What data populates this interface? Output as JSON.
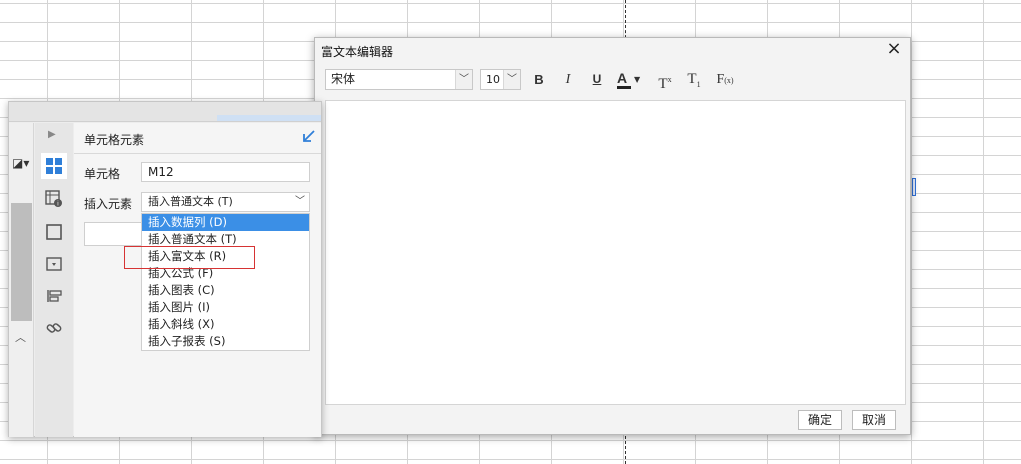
{
  "rich_text_editor": {
    "title": "富文本编辑器",
    "font_family": "宋体",
    "font_size": "10",
    "toolbar": {
      "bold": "B",
      "italic": "I",
      "underline": "U",
      "font_color": "A",
      "superscript": "T",
      "superscript_mark": "x",
      "subscript": "T",
      "subscript_mark": "1",
      "formula": "F",
      "formula_mark": "(x)"
    },
    "ok_label": "确定",
    "cancel_label": "取消"
  },
  "cell_panel": {
    "title": "单元格元素",
    "cell_label": "单元格",
    "cell_value": "M12",
    "insert_label": "插入元素",
    "insert_selected": "插入普通文本 (T)",
    "insert_options": [
      "插入数据列 (D)",
      "插入普通文本 (T)",
      "插入富文本 (R)",
      "插入公式 (F)",
      "插入图表 (C)",
      "插入图片 (I)",
      "插入斜线 (X)",
      "插入子报表 (S)"
    ],
    "highlighted_option_index": 0,
    "boxed_option_index": 2
  },
  "colors": {
    "accent": "#3b8fe6",
    "highlight_box": "#d63333",
    "selection_blue": "#2f6fd6"
  },
  "icons": [
    "close-icon",
    "dropdown-arrow-icon",
    "cell-element-icon",
    "cell-attribute-icon",
    "border-icon",
    "widget-icon",
    "condition-icon",
    "hyperlink-icon",
    "collapse-arrow-icon",
    "expand-arrow-icon",
    "format-painter-icon"
  ]
}
